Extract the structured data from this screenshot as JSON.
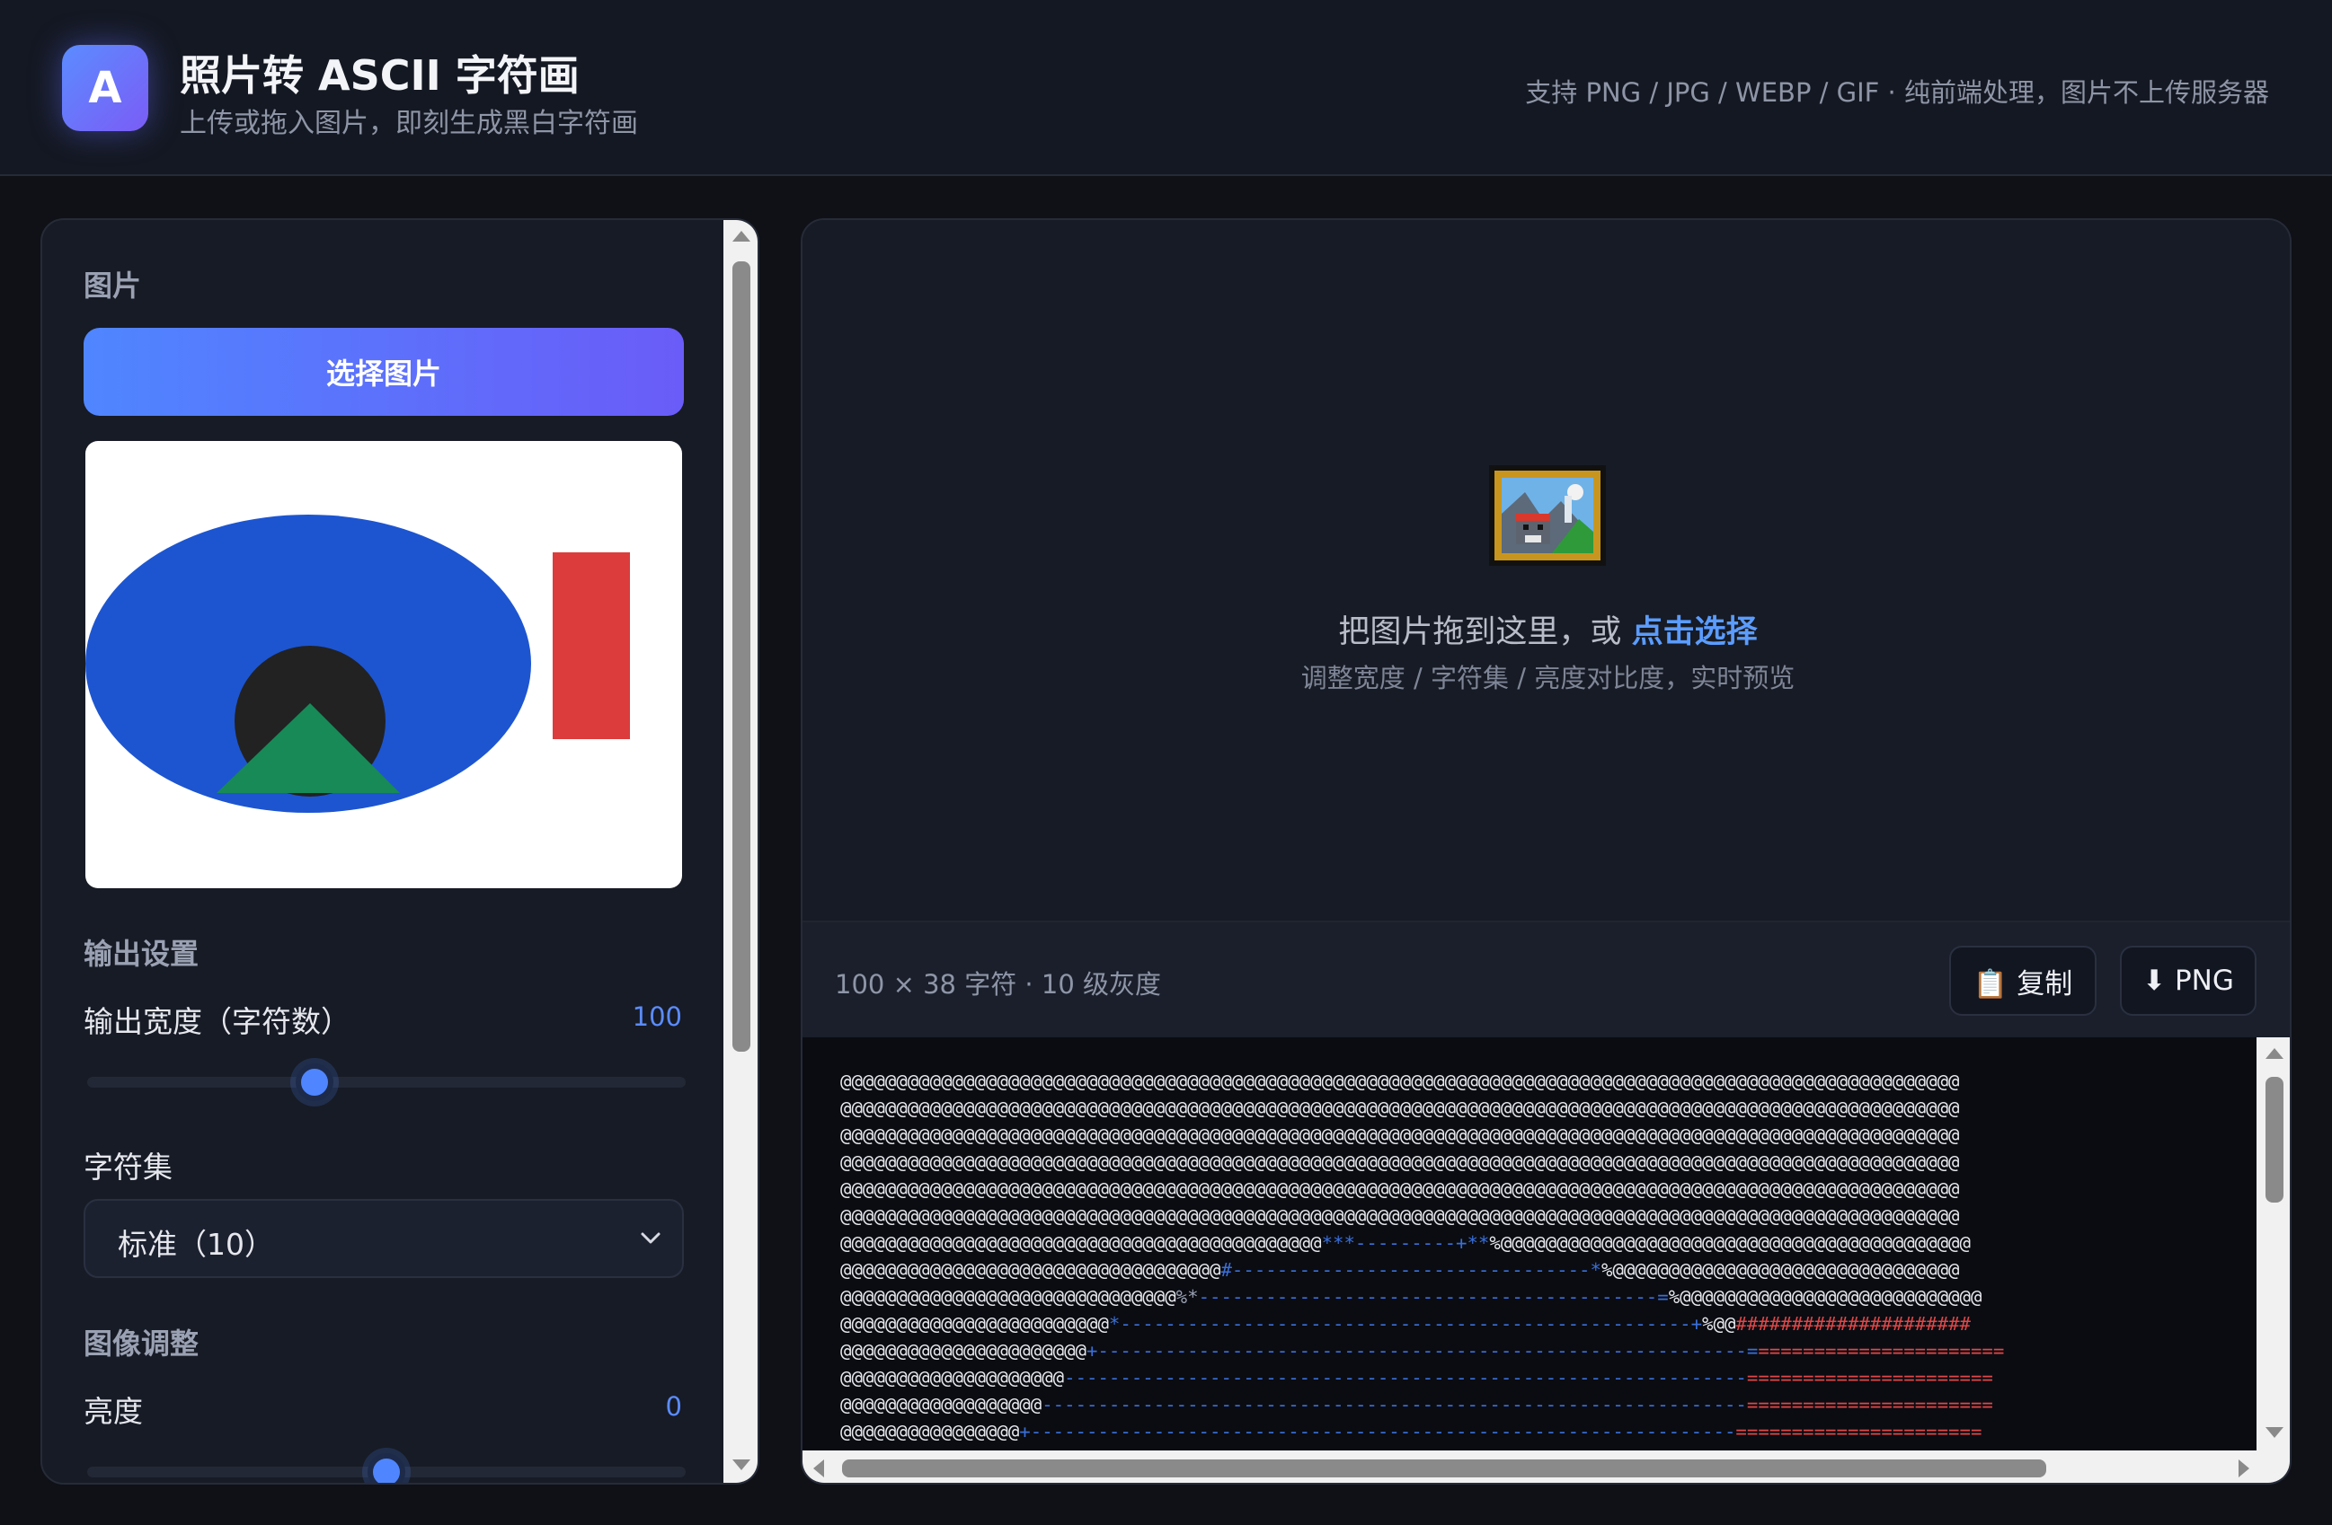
{
  "header": {
    "logo_letter": "A",
    "title": "照片转 ASCII 字符画",
    "subtitle": "上传或拖入图片，即刻生成黑白字符画",
    "note": "支持 PNG / JPG / WEBP / GIF · 纯前端处理，图片不上传服务器"
  },
  "sidebar": {
    "image_section": "图片",
    "choose_button": "选择图片",
    "output_section": "输出设置",
    "width_label": "输出宽度（字符数）",
    "width_value": "100",
    "width_fraction": 0.38,
    "charset_label": "字符集",
    "charset_selected": "标准（10）",
    "adjust_section": "图像调整",
    "brightness_label": "亮度",
    "brightness_value": "0",
    "brightness_fraction": 0.5
  },
  "preview_image": {
    "colors": {
      "ellipse": "#1d55d0",
      "rectangle": "#dc3c3c",
      "circle": "#222222",
      "triangle": "#178a58"
    }
  },
  "main": {
    "drop_text": "把图片拖到这里，或 ",
    "drop_link": "点击选择",
    "drop_hint": "调整宽度 / 字符集 / 亮度对比度，实时预览",
    "info": "100 × 38 字符 · 10 级灰度",
    "copy_button": "📋 复制",
    "png_button": "⬇ PNG",
    "ascii_lines": [
      [
        [
          "@@@@@@@@@@@@@@@@@@@@@@@@@@@@@@@@@@@@@@@@@@@@@@@@@@@@@@@@@@@@@@@@@@@@@@@@@@@@@@@@@@@@@@@@@@@@@@@@@@@@",
          ""
        ]
      ],
      [
        [
          "@@@@@@@@@@@@@@@@@@@@@@@@@@@@@@@@@@@@@@@@@@@@@@@@@@@@@@@@@@@@@@@@@@@@@@@@@@@@@@@@@@@@@@@@@@@@@@@@@@@@",
          ""
        ]
      ],
      [
        [
          "@@@@@@@@@@@@@@@@@@@@@@@@@@@@@@@@@@@@@@@@@@@@@@@@@@@@@@@@@@@@@@@@@@@@@@@@@@@@@@@@@@@@@@@@@@@@@@@@@@@@",
          ""
        ]
      ],
      [
        [
          "@@@@@@@@@@@@@@@@@@@@@@@@@@@@@@@@@@@@@@@@@@@@@@@@@@@@@@@@@@@@@@@@@@@@@@@@@@@@@@@@@@@@@@@@@@@@@@@@@@@@",
          ""
        ]
      ],
      [
        [
          "@@@@@@@@@@@@@@@@@@@@@@@@@@@@@@@@@@@@@@@@@@@@@@@@@@@@@@@@@@@@@@@@@@@@@@@@@@@@@@@@@@@@@@@@@@@@@@@@@@@@",
          ""
        ]
      ],
      [
        [
          "@@@@@@@@@@@@@@@@@@@@@@@@@@@@@@@@@@@@@@@@@@@@@@@@@@@@@@@@@@@@@@@@@@@@@@@@@@@@@@@@@@@@@@@@@@@@@@@@@@@@",
          ""
        ]
      ],
      [
        [
          "@@@@@@@@@@@@@@@@@@@@@@@@@@@@@@@@@@@@@@@@@@@",
          ""
        ],
        [
          "***---------+**",
          "c-blue"
        ],
        [
          "%@@@@@@@@@@@@@@@@@@@@@@@@@@@@@@@@@@@@@@@@@@",
          ""
        ]
      ],
      [
        [
          "@@@@@@@@@@@@@@@@@@@@@@@@@@@@@@@@@@",
          ""
        ],
        [
          "#--------------------------------*",
          "c-blue"
        ],
        [
          "%@@@@@@@@@@@@@@@@@@@@@@@@@@@@@@@",
          ""
        ]
      ],
      [
        [
          "@@@@@@@@@@@@@@@@@@@@@@@@@@@@@@",
          ""
        ],
        [
          "%*",
          "c-dim"
        ],
        [
          "-----------------------------------------=",
          "c-blue"
        ],
        [
          "%@@@@@@@@@@@@@@@@@@@@@@@@@@@",
          ""
        ]
      ],
      [
        [
          "@@@@@@@@@@@@@@@@@@@@@@@@",
          ""
        ],
        [
          "*---------------------------------------------------+",
          "c-blue"
        ],
        [
          "%@@",
          ""
        ],
        [
          "#####################",
          "c-red"
        ]
      ],
      [
        [
          "@@@@@@@@@@@@@@@@@@@@@@",
          ""
        ],
        [
          "+----------------------------------------------------------=",
          "c-blue"
        ],
        [
          "======================",
          "c-red"
        ]
      ],
      [
        [
          "@@@@@@@@@@@@@@@@@@@@",
          ""
        ],
        [
          "-------------------------------------------------------------",
          "c-blue"
        ],
        [
          "======================",
          "c-red"
        ]
      ],
      [
        [
          "@@@@@@@@@@@@@@@@@@",
          ""
        ],
        [
          "---------------------------------------------------------------",
          "c-blue"
        ],
        [
          "======================",
          "c-red"
        ]
      ],
      [
        [
          "@@@@@@@@@@@@@@@@",
          ""
        ],
        [
          "+---------------------------------------------------------------",
          "c-blue"
        ],
        [
          "======================",
          "c-red"
        ]
      ]
    ]
  }
}
